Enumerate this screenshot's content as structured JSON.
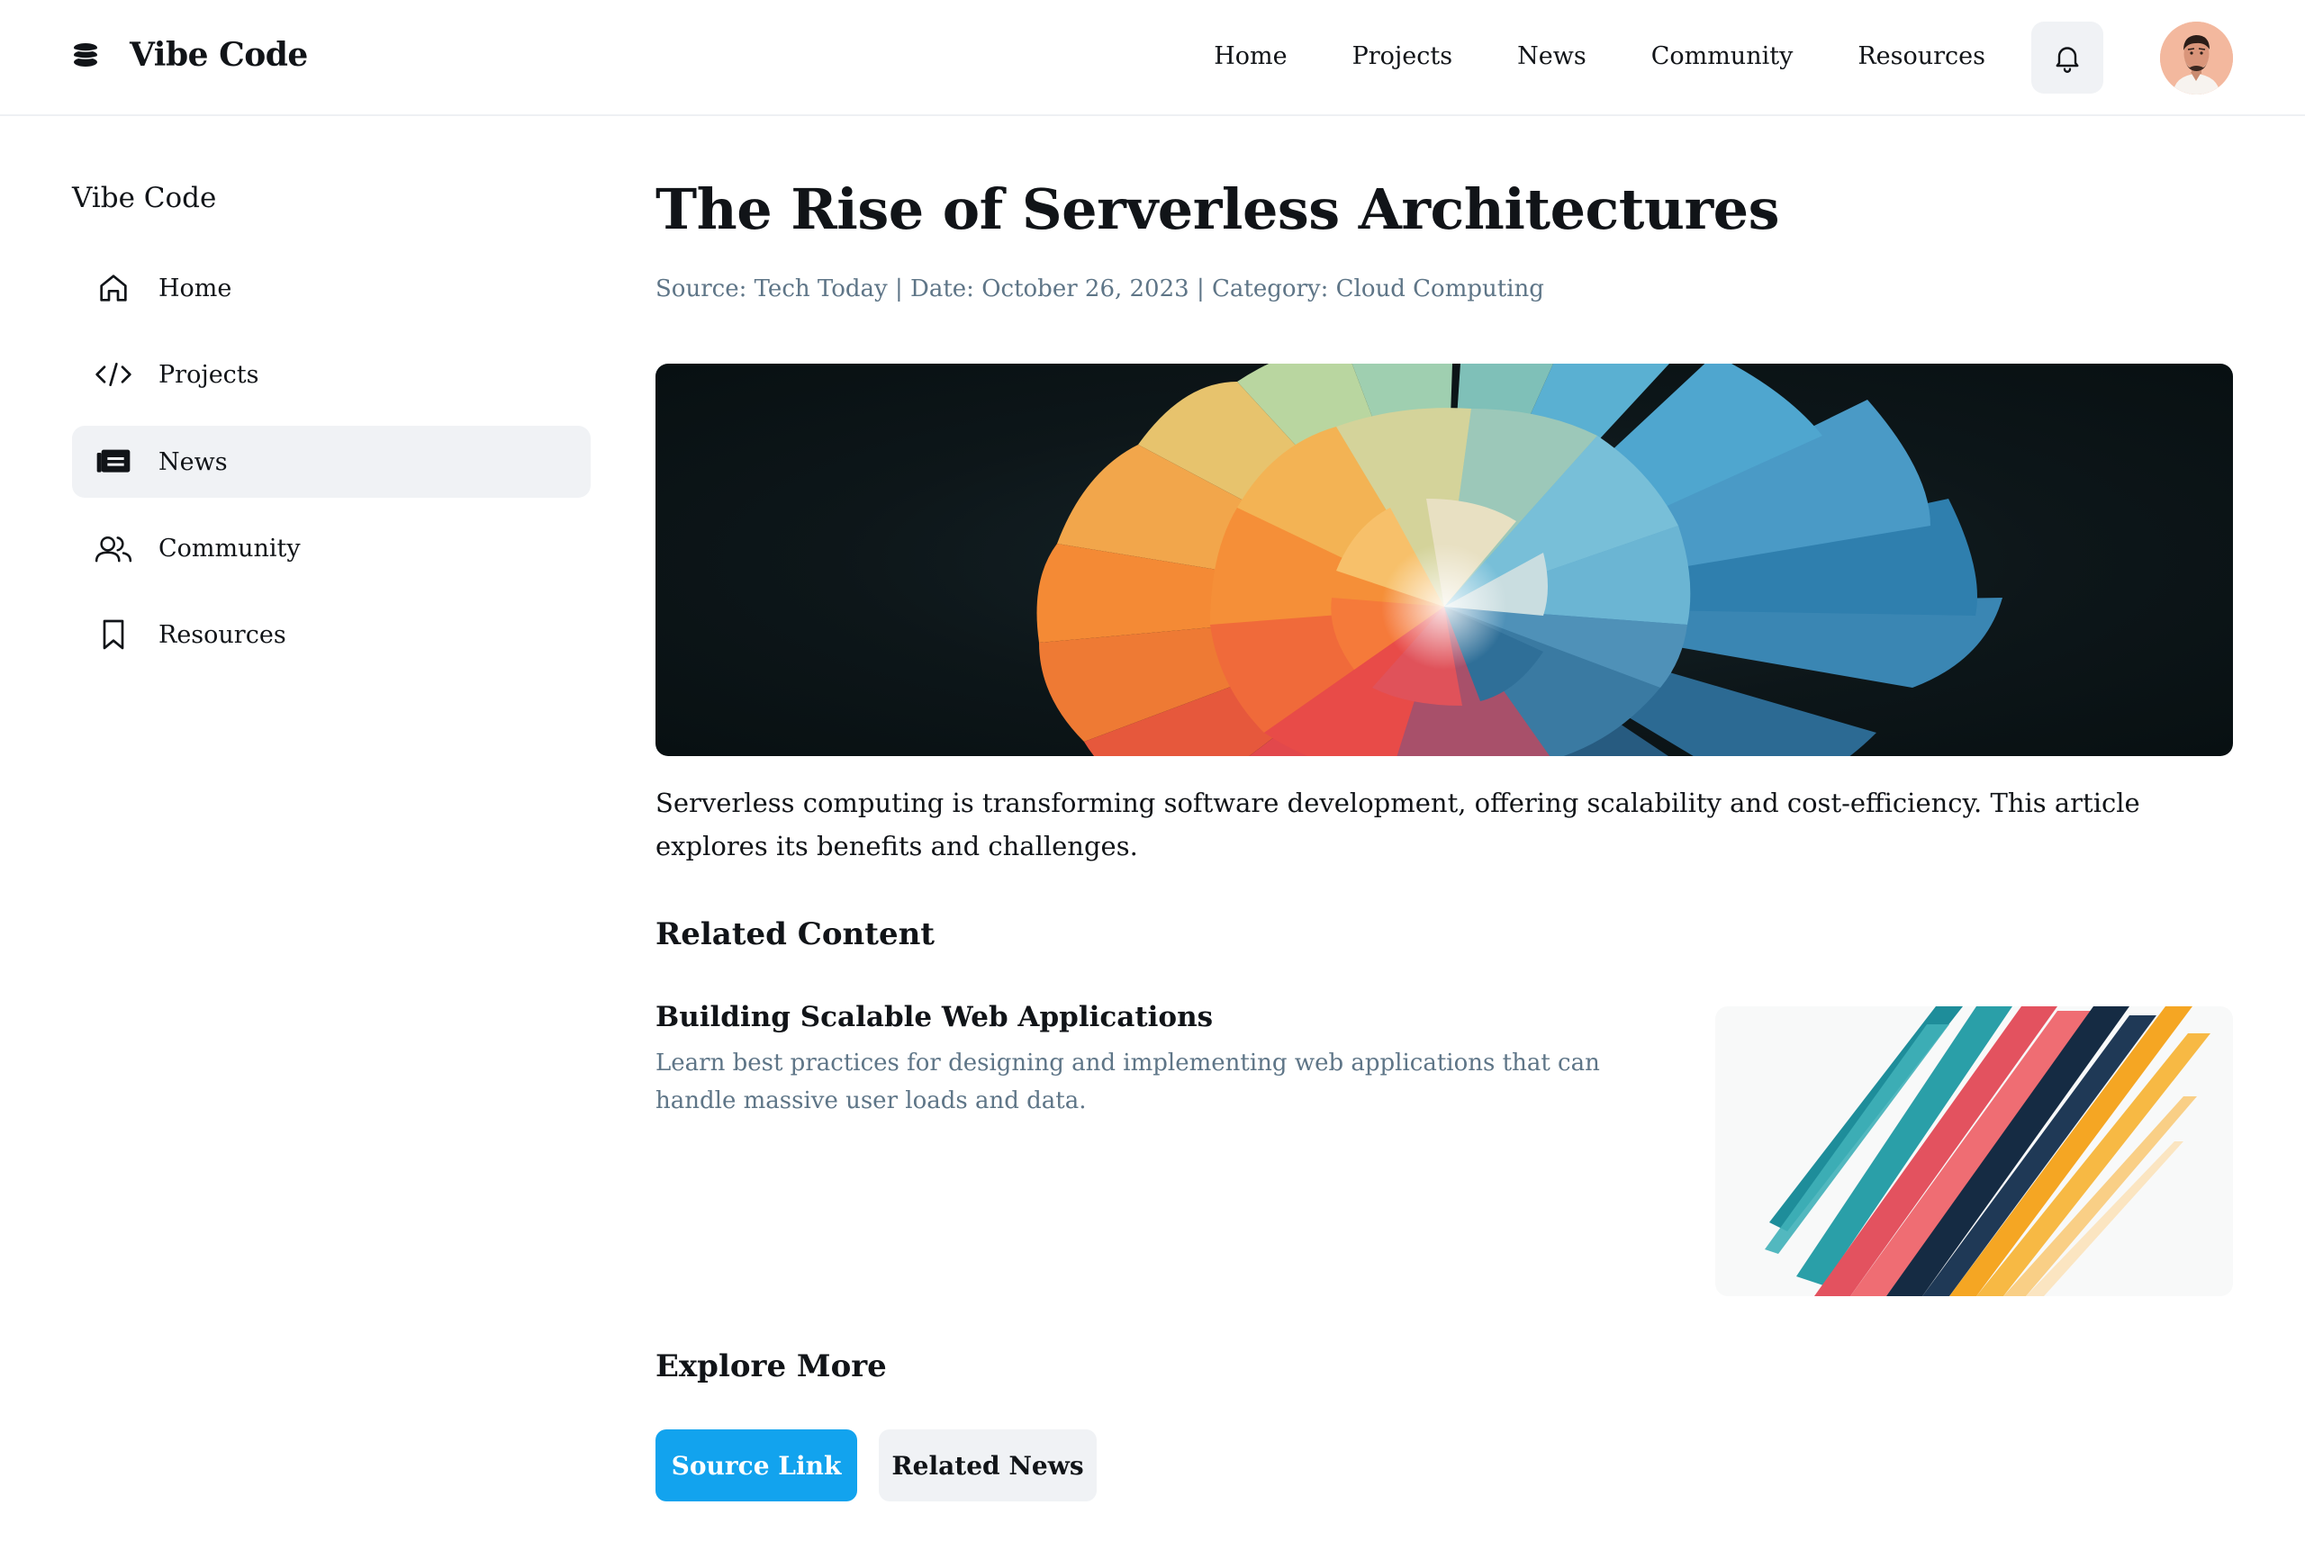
{
  "header": {
    "brand": "Vibe Code",
    "nav": [
      "Home",
      "Projects",
      "News",
      "Community",
      "Resources"
    ],
    "icons": {
      "brand": "stack-icon",
      "notifications": "bell-icon"
    }
  },
  "sidebar": {
    "title": "Vibe Code",
    "items": [
      {
        "label": "Home",
        "icon": "home-icon"
      },
      {
        "label": "Projects",
        "icon": "code-icon"
      },
      {
        "label": "News",
        "icon": "newspaper-icon",
        "active": true
      },
      {
        "label": "Community",
        "icon": "users-icon"
      },
      {
        "label": "Resources",
        "icon": "bookmark-icon"
      }
    ]
  },
  "article": {
    "title": "The Rise of Serverless Architectures",
    "meta": "Source: Tech Today | Date: October 26, 2023 | Category: Cloud Computing",
    "summary": "Serverless computing is transforming software development, offering scalability and cost-efficiency. This article explores its benefits and challenges."
  },
  "related": {
    "heading": "Related Content",
    "items": [
      {
        "title": "Building Scalable Web Applications",
        "description": "Learn best practices for designing and implementing web applications that can handle massive user loads and data."
      }
    ]
  },
  "explore": {
    "heading": "Explore More",
    "primary_button": "Source Link",
    "secondary_button": "Related News"
  },
  "colors": {
    "accent": "#12a3ee",
    "muted_text": "#5e7587",
    "surface": "#f0f2f5"
  }
}
